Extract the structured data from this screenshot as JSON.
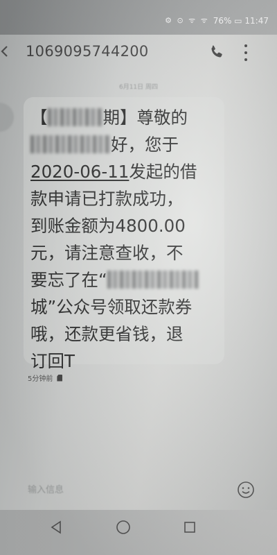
{
  "status_bar": {
    "indicators": "⚙ ⊙ ᯤ ᯤ",
    "battery_time": "76% ▭ 11:47",
    "icons": [
      "settings-icon",
      "alarm-icon",
      "signal-icon",
      "signal-icon",
      "battery-icon"
    ]
  },
  "header": {
    "sender": "1069095744200",
    "icons": [
      "back-icon",
      "phone-icon",
      "more-vertical-icon"
    ]
  },
  "divider": {
    "date_text": "6月11日 周四"
  },
  "message": {
    "lines": [
      {
        "pre": "【",
        "post": "期】尊敬的"
      },
      {
        "pre": "",
        "post": "好，您于"
      },
      {
        "date": "2020-06-11",
        "post": "发起的借"
      },
      {
        "text": "款申请已打款成功，"
      },
      {
        "text": "到账金额为4800.00"
      },
      {
        "text": "元，请注意查收，不"
      },
      {
        "pre": "要忘了在“",
        "post": ""
      },
      {
        "text": "城”公众号领取还款券"
      },
      {
        "text": "哦，还款更省钱，退"
      },
      {
        "text": "订回T"
      }
    ],
    "time": "5分钟前",
    "sim_icon": "sim-card-icon"
  },
  "composer": {
    "placeholder": "输入信息",
    "icon": "emoji-icon"
  },
  "nav_bar": {
    "icons": [
      "nav-back-icon",
      "nav-home-icon",
      "nav-recent-icon"
    ]
  },
  "colors": {
    "text": "#2a2b2b",
    "background": "#d7d9d8",
    "status_bar": "#9c9fa0"
  }
}
